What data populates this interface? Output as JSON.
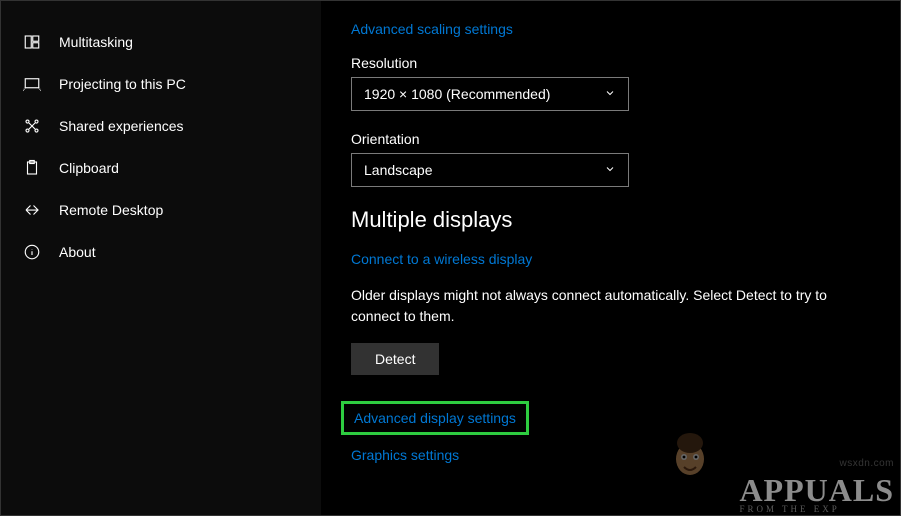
{
  "sidebar": {
    "items": [
      {
        "label": "Multitasking"
      },
      {
        "label": "Projecting to this PC"
      },
      {
        "label": "Shared experiences"
      },
      {
        "label": "Clipboard"
      },
      {
        "label": "Remote Desktop"
      },
      {
        "label": "About"
      }
    ]
  },
  "main": {
    "scaling_link": "Advanced scaling settings",
    "resolution_label": "Resolution",
    "resolution_value": "1920 × 1080 (Recommended)",
    "orientation_label": "Orientation",
    "orientation_value": "Landscape",
    "multiple_displays_heading": "Multiple displays",
    "wireless_link": "Connect to a wireless display",
    "detect_description": "Older displays might not always connect automatically. Select Detect to try to connect to them.",
    "detect_button": "Detect",
    "advanced_display_link": "Advanced display settings",
    "graphics_link": "Graphics settings"
  },
  "watermark": {
    "brand": "APPUALS",
    "tagline": "FROM THE EXP",
    "url": "wsxdn.com"
  }
}
